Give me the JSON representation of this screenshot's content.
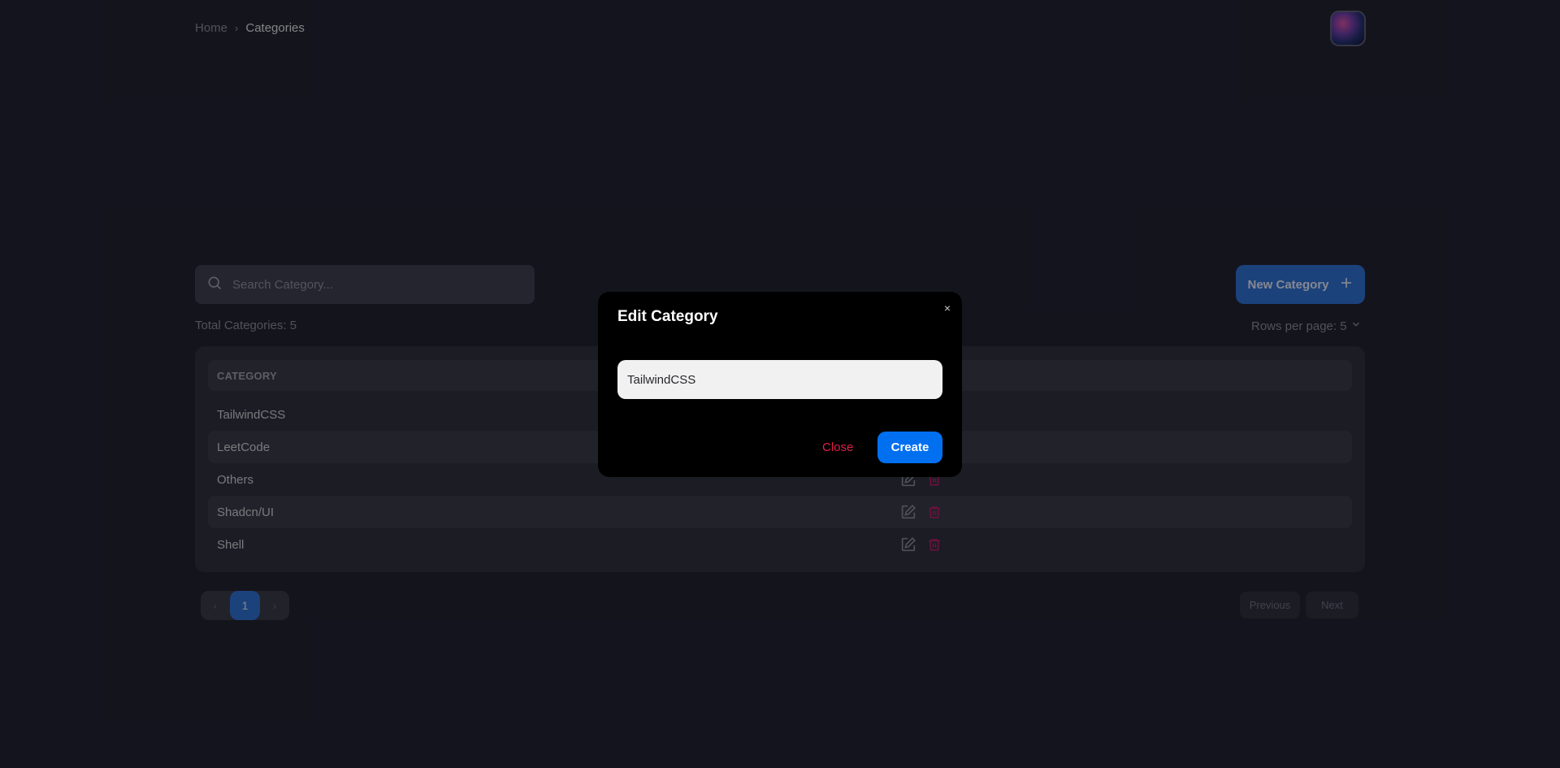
{
  "breadcrumb": {
    "home": "Home",
    "separator": "›",
    "current": "Categories"
  },
  "search": {
    "placeholder": "Search Category..."
  },
  "toolbar": {
    "new_label": "New Category"
  },
  "summary": {
    "total": "Total Categories: 5",
    "rows_per_page": "Rows per page: 5"
  },
  "table": {
    "header": "CATEGORY",
    "rows": [
      "TailwindCSS",
      "LeetCode",
      "Others",
      "Shadcn/UI",
      "Shell"
    ]
  },
  "pagination": {
    "current_page": "1",
    "prev_arrow": "‹",
    "next_arrow": "›",
    "previous": "Previous",
    "next": "Next"
  },
  "modal": {
    "title": "Edit Category",
    "close_icon": "×",
    "input_value": "TailwindCSS",
    "close_label": "Close",
    "submit_label": "Create"
  },
  "colors": {
    "accent": "#2b6fd6",
    "modal_primary": "#0070f0",
    "danger": "#e11d48",
    "background": "#1c1d29"
  }
}
